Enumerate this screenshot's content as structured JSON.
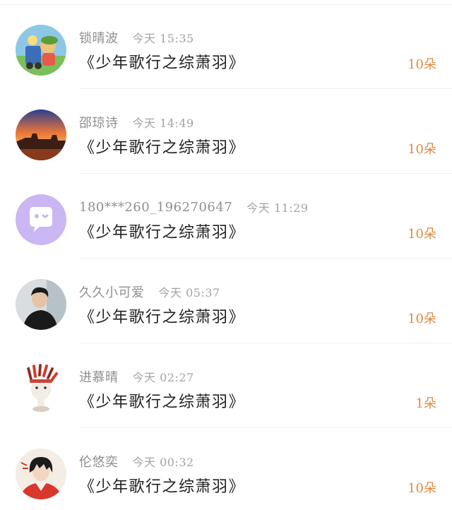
{
  "items": [
    {
      "name": "锁晴波",
      "time": "今天 15:35",
      "title": "《少年歌行之综萧羽》",
      "count": "10朵",
      "avatar": "cartoon-avatar"
    },
    {
      "name": "邵琼诗",
      "time": "今天 14:49",
      "title": "《少年歌行之综萧羽》",
      "count": "10朵",
      "avatar": "sunset-avatar"
    },
    {
      "name": "180***260_196270647",
      "time": "今天 11:29",
      "title": "《少年歌行之综萧羽》",
      "count": "10朵",
      "avatar": "chat-bubble-avatar"
    },
    {
      "name": "久久小可爱",
      "time": "今天 05:37",
      "title": "《少年歌行之综萧羽》",
      "count": "10朵",
      "avatar": "person-avatar"
    },
    {
      "name": "进慕晴",
      "time": "今天 02:27",
      "title": "《少年歌行之综萧羽》",
      "count": "1朵",
      "avatar": "headdress-avatar"
    },
    {
      "name": "伦悠奕",
      "time": "今天 00:32",
      "title": "《少年歌行之综萧羽》",
      "count": "10朵",
      "avatar": "anime-avatar"
    }
  ],
  "colors": {
    "count": "#e08a40",
    "name": "#8f8f8f",
    "title": "#222222",
    "avatar_purple": "#c9b6f3"
  }
}
